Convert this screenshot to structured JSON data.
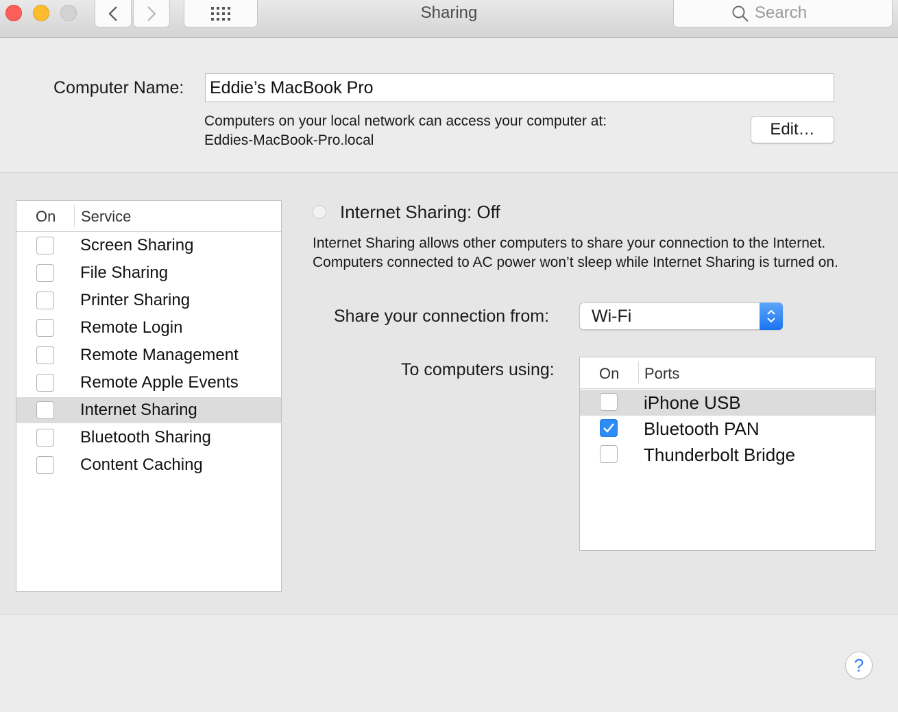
{
  "window": {
    "title": "Sharing"
  },
  "toolbar": {
    "back_icon": "chevron-left-icon",
    "forward_icon": "chevron-right-icon",
    "show_all_icon": "grid-icon",
    "search_placeholder": "Search"
  },
  "computer_name": {
    "label": "Computer Name:",
    "value": "Eddie’s MacBook Pro",
    "info_line1": "Computers on your local network can access your computer at:",
    "info_line2": "Eddies-MacBook-Pro.local",
    "edit_label": "Edit…"
  },
  "services": {
    "header_on": "On",
    "header_service": "Service",
    "items": [
      {
        "label": "Screen Sharing",
        "on": false
      },
      {
        "label": "File Sharing",
        "on": false
      },
      {
        "label": "Printer Sharing",
        "on": false
      },
      {
        "label": "Remote Login",
        "on": false
      },
      {
        "label": "Remote Management",
        "on": false
      },
      {
        "label": "Remote Apple Events",
        "on": false
      },
      {
        "label": "Internet Sharing",
        "on": false,
        "selected": true
      },
      {
        "label": "Bluetooth Sharing",
        "on": false
      },
      {
        "label": "Content Caching",
        "on": false
      }
    ]
  },
  "internet_sharing": {
    "status_title": "Internet Sharing: Off",
    "description": "Internet Sharing allows other computers to share your connection to the Internet. Computers connected to AC power won’t sleep while Internet Sharing is turned on.",
    "share_from_label": "Share your connection from:",
    "share_from_value": "Wi-Fi",
    "to_computers_label": "To computers using:",
    "ports_header_on": "On",
    "ports_header_ports": "Ports",
    "ports": [
      {
        "label": "iPhone USB",
        "on": false,
        "selected": true
      },
      {
        "label": "Bluetooth PAN",
        "on": true
      },
      {
        "label": "Thunderbolt Bridge",
        "on": false
      }
    ]
  },
  "help": {
    "label": "?"
  },
  "colors": {
    "accent": "#2f8cf6",
    "selection": "#dcdcdc",
    "background": "#ececec"
  }
}
